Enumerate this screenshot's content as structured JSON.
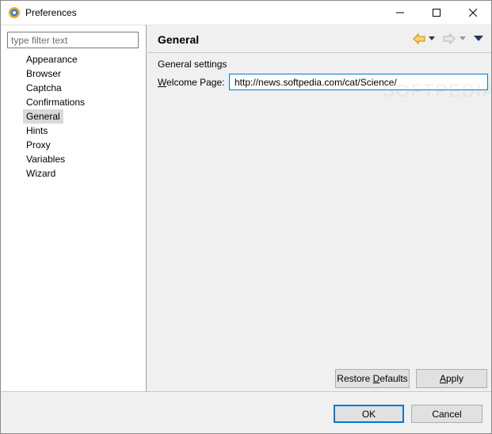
{
  "window": {
    "title": "Preferences"
  },
  "filter": {
    "placeholder": "type filter text"
  },
  "tree": {
    "items": [
      "Appearance",
      "Browser",
      "Captcha",
      "Confirmations",
      "General",
      "Hints",
      "Proxy",
      "Variables",
      "Wizard"
    ],
    "selected": "General"
  },
  "page": {
    "title": "General",
    "group_label": "General settings",
    "welcome_label_underlined": "W",
    "welcome_label_rest": "elcome Page:",
    "welcome_value": "http://news.softpedia.com/cat/Science/"
  },
  "buttons": {
    "restore_prefix": "Restore ",
    "restore_underlined": "D",
    "restore_suffix": "efaults",
    "apply_underlined": "A",
    "apply_rest": "pply",
    "ok": "OK",
    "cancel": "Cancel"
  },
  "watermark": "SOFTPEDIA",
  "colors": {
    "accent": "#0078d7",
    "selection": "#d9d9d9",
    "nav_back": "#f0b429"
  },
  "icons": {
    "back": "back-arrow-icon",
    "forward": "forward-arrow-icon",
    "menu": "view-menu-icon"
  }
}
